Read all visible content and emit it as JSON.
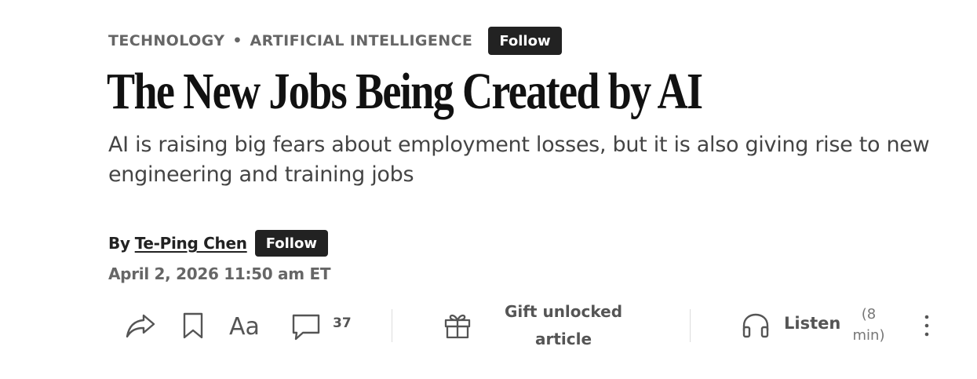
{
  "breadcrumb": {
    "items": [
      "TECHNOLOGY",
      "ARTIFICIAL INTELLIGENCE"
    ],
    "separator": "•",
    "follow_label": "Follow"
  },
  "headline": "The New Jobs Being Created by AI",
  "dek": "AI is raising big fears about employment losses, but it is also giving rise to new engineering and training jobs",
  "byline": {
    "by_label": "By",
    "author": "Te-Ping Chen",
    "follow_label": "Follow"
  },
  "timestamp": "April 2, 2026 11:50 am ET",
  "toolbar": {
    "icons": [
      "share-icon",
      "bookmark-icon",
      "text-size-icon",
      "comment-icon",
      "gift-icon",
      "headphones-icon",
      "more-vertical-icon"
    ],
    "comment_count": "37",
    "gift_label": "Gift unlocked article",
    "listen_label": "Listen",
    "listen_duration": "(8 min)"
  },
  "colors": {
    "button_bg": "#222222",
    "muted_text": "#666666",
    "icon_color": "#555555"
  }
}
